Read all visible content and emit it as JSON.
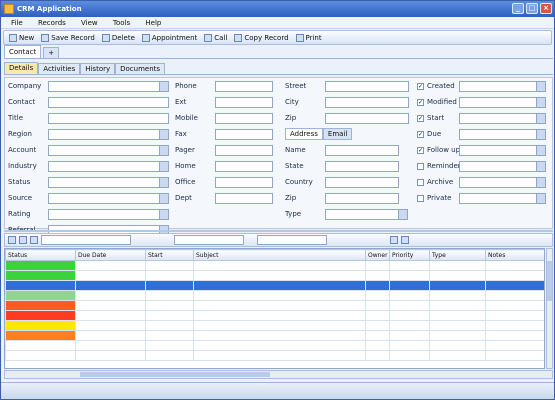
{
  "window": {
    "title": "CRM Application",
    "min": "_",
    "max": "□",
    "close": "×"
  },
  "menu": [
    "File",
    "Records",
    "View",
    "Tools",
    "Help"
  ],
  "toolbar": [
    {
      "icon": "new-record-icon",
      "label": "New"
    },
    {
      "icon": "save-icon",
      "label": "Save Record"
    },
    {
      "icon": "delete-icon",
      "label": "Delete"
    },
    {
      "icon": "calendar-icon",
      "label": "Appointment"
    },
    {
      "icon": "phone-icon",
      "label": "Call"
    },
    {
      "icon": "copy-icon",
      "label": "Copy Record"
    },
    {
      "icon": "print-icon",
      "label": "Print"
    }
  ],
  "top_tabs": [
    "Contact",
    "+"
  ],
  "sub_tabs": [
    "Details",
    "Activities",
    "History",
    "Documents"
  ],
  "form": {
    "col1": [
      {
        "label": "Company",
        "value": "",
        "type": "dd"
      },
      {
        "label": "Contact",
        "value": "",
        "type": "text"
      },
      {
        "label": "Title",
        "value": "",
        "type": "text"
      },
      {
        "label": "Region",
        "value": "",
        "type": "dd"
      },
      {
        "label": "Account",
        "value": "",
        "type": "dd"
      },
      {
        "label": "Industry",
        "value": "",
        "type": "dd"
      },
      {
        "label": "Status",
        "value": "",
        "type": "dd"
      },
      {
        "label": "Source",
        "value": "",
        "type": "dd"
      },
      {
        "label": "Rating",
        "value": "",
        "type": "dd"
      },
      {
        "label": "Referral",
        "value": "",
        "type": "dd"
      }
    ],
    "col2": [
      {
        "label": "Phone",
        "value": ""
      },
      {
        "label": "Ext",
        "value": ""
      },
      {
        "label": "Mobile",
        "value": ""
      },
      {
        "label": "Fax",
        "value": ""
      },
      {
        "label": "Pager",
        "value": ""
      },
      {
        "label": "Home",
        "value": ""
      },
      {
        "label": "Office",
        "value": ""
      },
      {
        "label": "Dept",
        "value": ""
      }
    ],
    "col3": [
      {
        "label": "Street",
        "value": ""
      },
      {
        "label": "City",
        "value": ""
      },
      {
        "label": "Zip",
        "value": ""
      }
    ],
    "col3_tabs": [
      "Address",
      "Email"
    ],
    "col3_lower": [
      {
        "label": "Name",
        "value": ""
      },
      {
        "label": "State",
        "value": ""
      },
      {
        "label": "Country",
        "value": ""
      },
      {
        "label": "Zip",
        "value": ""
      },
      {
        "label": "Type",
        "value": ""
      }
    ],
    "col3_note": "",
    "col4": [
      {
        "label": "Created",
        "value": "",
        "checked": true
      },
      {
        "label": "Modified",
        "value": "",
        "checked": true
      },
      {
        "label": "Start",
        "value": "",
        "checked": true
      },
      {
        "label": "Due",
        "value": "",
        "checked": true
      },
      {
        "label": "Follow up",
        "value": "",
        "checked": true
      },
      {
        "label": "Reminder",
        "value": "",
        "checked": false
      },
      {
        "label": "Archive",
        "value": "",
        "checked": false
      },
      {
        "label": "Private",
        "value": "",
        "checked": false
      }
    ],
    "col4_footer": ""
  },
  "grid_bar": {
    "filter": "",
    "view": "",
    "group": ""
  },
  "grid": {
    "columns": [
      "Status",
      "Due Date",
      "Start",
      "Subject",
      "Owner",
      "Priority",
      "Type",
      "Notes"
    ],
    "rows": [
      {
        "status": "",
        "color": "#3cd23c",
        "sel": false,
        "cells": [
          "",
          "",
          "",
          "",
          "",
          "",
          "",
          ""
        ]
      },
      {
        "status": "",
        "color": "#3cd23c",
        "sel": false,
        "cells": [
          "",
          "",
          "",
          "",
          "",
          "",
          "",
          ""
        ]
      },
      {
        "status": "",
        "color": "#2f6fd6",
        "sel": true,
        "cells": [
          "",
          "",
          "",
          "",
          "",
          "",
          "",
          ""
        ]
      },
      {
        "status": "",
        "color": "#8fd48f",
        "sel": false,
        "cells": [
          "",
          "",
          "",
          "",
          "",
          "",
          "",
          ""
        ]
      },
      {
        "status": "",
        "color": "#ff5a1f",
        "sel": false,
        "cells": [
          "",
          "",
          "",
          "",
          "",
          "",
          "",
          ""
        ]
      },
      {
        "status": "",
        "color": "#ff3c1f",
        "sel": false,
        "cells": [
          "",
          "",
          "",
          "",
          "",
          "",
          "",
          ""
        ]
      },
      {
        "status": "",
        "color": "#ffe600",
        "sel": false,
        "cells": [
          "",
          "",
          "",
          "",
          "",
          "",
          "",
          ""
        ]
      },
      {
        "status": "",
        "color": "#ff7f1f",
        "sel": false,
        "cells": [
          "",
          "",
          "",
          "",
          "",
          "",
          "",
          ""
        ]
      },
      {
        "status": "",
        "color": "#ffffff",
        "sel": false,
        "cells": [
          "",
          "",
          "",
          "",
          "",
          "",
          "",
          ""
        ]
      },
      {
        "status": "",
        "color": "#ffffff",
        "sel": false,
        "cells": [
          "",
          "",
          "",
          "",
          "",
          "",
          "",
          ""
        ]
      }
    ]
  },
  "pager": "",
  "status_left": "",
  "status_right": ""
}
